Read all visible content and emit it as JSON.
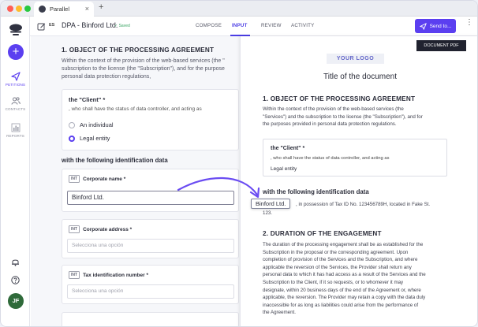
{
  "browser": {
    "tab_title": "Parallel",
    "tab_close": "×",
    "new_tab": "+"
  },
  "sidebar": {
    "add_label": "+",
    "items": [
      {
        "label": "PETITIONS",
        "icon": "paper-plane-icon",
        "active": true
      },
      {
        "label": "CONTACTS",
        "icon": "users-icon",
        "active": false
      },
      {
        "label": "REPORTS",
        "icon": "bar-chart-icon",
        "active": false
      }
    ],
    "avatar_initials": "JF"
  },
  "topbar": {
    "lang_badge": "ES",
    "doc_title": "DPA - Binford Ltd.",
    "saved_label": "✓ Saved",
    "tabs": [
      {
        "label": "COMPOSE",
        "active": false
      },
      {
        "label": "INPUT",
        "active": true
      },
      {
        "label": "REVIEW",
        "active": false
      },
      {
        "label": "ACTIVITY",
        "active": false
      }
    ],
    "send_label": "Send to...",
    "kebab": "⋮"
  },
  "form": {
    "section1_title": "1. OBJECT OF THE PROCESSING AGREEMENT",
    "section1_text_lines": [
      "Within the context of the provision of the web-based services (the \"",
      "subscription to the license (the \"Subscription\"), and for the purpose",
      "personal data protection regulations,"
    ],
    "client": {
      "label": "the \"Client\" *",
      "sub": ", who shall have the status of data controller, and acting as",
      "options": [
        {
          "label": "An individual",
          "checked": false
        },
        {
          "label": "Legal entity",
          "checked": true
        }
      ]
    },
    "ident_title": "with the following identification data",
    "fields": [
      {
        "tag": "INT",
        "label": "Corporate name *",
        "value": "Binford Ltd.",
        "placeholder": ""
      },
      {
        "tag": "INT",
        "label": "Corporate address *",
        "value": "",
        "placeholder": "Selecciona una opción"
      },
      {
        "tag": "INT",
        "label": "Tax identification number *",
        "value": "",
        "placeholder": "Selecciona una opción"
      }
    ]
  },
  "preview": {
    "pdf_button": "DOCUMENT PDF",
    "logo_text": "YOUR LOGO",
    "title": "Title of the document",
    "section1_title": "1. OBJECT OF THE PROCESSING AGREEMENT",
    "section1_lines": [
      "Within the context of the provision of the web-based services (the",
      "\"Services\") and the subscription to the license (the \"Subscription\"), and for",
      "the purposes provided in personal data protection regulations."
    ],
    "client_label": "the \"Client\" *",
    "client_sub": ", who shall have the status of data controller, and acting as",
    "client_value": "Legal entity",
    "ident_title": "with the following identification data",
    "highlight": "Binford Ltd.",
    "ident_rest": ", in possession of Tax ID No. 123456789H, located in Fake St.",
    "ident_rest2": "123.",
    "section2_title": "2. DURATION OF THE ENGAGEMENT",
    "section2_lines": [
      "The duration of the processing engagement shall be as established for the",
      "Subscription in the proposal or the corresponding agreement. Upon",
      "completion of provision of the Services and the Subscription, and where",
      "applicable the reversion of the Services, the Provider shall return any",
      "personal data to which it has had access as a result of the Services and the",
      "Subscription to the Client, if it so requests, or to whomever it may",
      "designate, within 20 business days of the end of the Agreement or, where",
      "applicable, the reversion. The Provider may retain a copy with the data duly",
      "inaccessible for as long as liabilities could arise from the performance of",
      "the Agreement."
    ]
  },
  "colors": {
    "accent": "#5b3ff0",
    "saved_green": "#3aa564"
  }
}
